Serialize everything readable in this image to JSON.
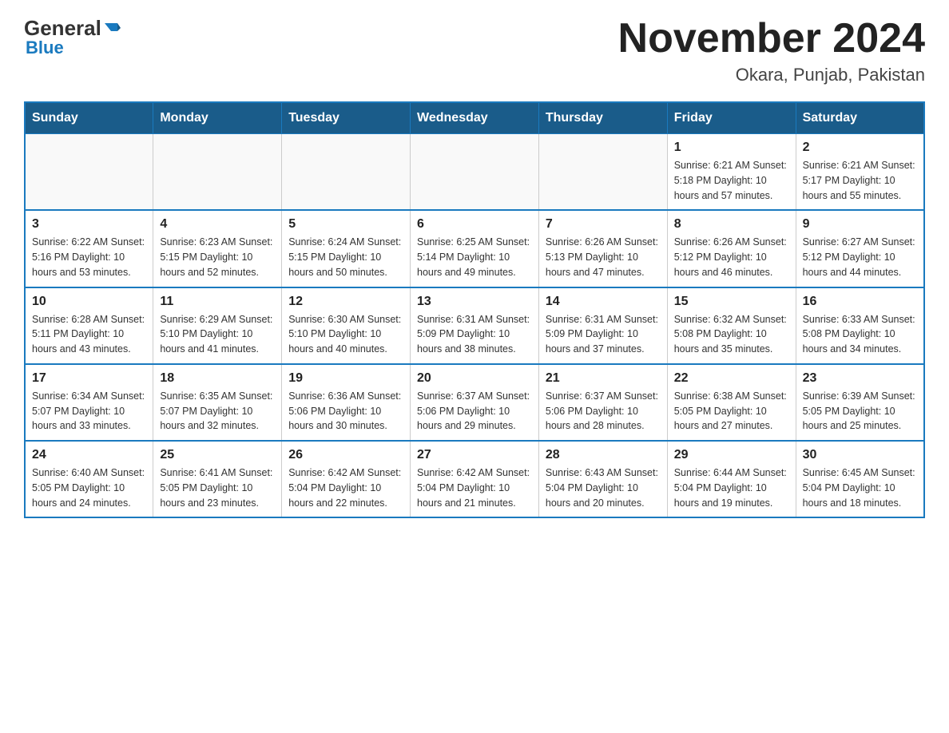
{
  "header": {
    "logo": {
      "general": "General",
      "blue": "Blue"
    },
    "title": "November 2024",
    "location": "Okara, Punjab, Pakistan"
  },
  "calendar": {
    "days_of_week": [
      "Sunday",
      "Monday",
      "Tuesday",
      "Wednesday",
      "Thursday",
      "Friday",
      "Saturday"
    ],
    "weeks": [
      [
        {
          "day": "",
          "info": ""
        },
        {
          "day": "",
          "info": ""
        },
        {
          "day": "",
          "info": ""
        },
        {
          "day": "",
          "info": ""
        },
        {
          "day": "",
          "info": ""
        },
        {
          "day": "1",
          "info": "Sunrise: 6:21 AM\nSunset: 5:18 PM\nDaylight: 10 hours\nand 57 minutes."
        },
        {
          "day": "2",
          "info": "Sunrise: 6:21 AM\nSunset: 5:17 PM\nDaylight: 10 hours\nand 55 minutes."
        }
      ],
      [
        {
          "day": "3",
          "info": "Sunrise: 6:22 AM\nSunset: 5:16 PM\nDaylight: 10 hours\nand 53 minutes."
        },
        {
          "day": "4",
          "info": "Sunrise: 6:23 AM\nSunset: 5:15 PM\nDaylight: 10 hours\nand 52 minutes."
        },
        {
          "day": "5",
          "info": "Sunrise: 6:24 AM\nSunset: 5:15 PM\nDaylight: 10 hours\nand 50 minutes."
        },
        {
          "day": "6",
          "info": "Sunrise: 6:25 AM\nSunset: 5:14 PM\nDaylight: 10 hours\nand 49 minutes."
        },
        {
          "day": "7",
          "info": "Sunrise: 6:26 AM\nSunset: 5:13 PM\nDaylight: 10 hours\nand 47 minutes."
        },
        {
          "day": "8",
          "info": "Sunrise: 6:26 AM\nSunset: 5:12 PM\nDaylight: 10 hours\nand 46 minutes."
        },
        {
          "day": "9",
          "info": "Sunrise: 6:27 AM\nSunset: 5:12 PM\nDaylight: 10 hours\nand 44 minutes."
        }
      ],
      [
        {
          "day": "10",
          "info": "Sunrise: 6:28 AM\nSunset: 5:11 PM\nDaylight: 10 hours\nand 43 minutes."
        },
        {
          "day": "11",
          "info": "Sunrise: 6:29 AM\nSunset: 5:10 PM\nDaylight: 10 hours\nand 41 minutes."
        },
        {
          "day": "12",
          "info": "Sunrise: 6:30 AM\nSunset: 5:10 PM\nDaylight: 10 hours\nand 40 minutes."
        },
        {
          "day": "13",
          "info": "Sunrise: 6:31 AM\nSunset: 5:09 PM\nDaylight: 10 hours\nand 38 minutes."
        },
        {
          "day": "14",
          "info": "Sunrise: 6:31 AM\nSunset: 5:09 PM\nDaylight: 10 hours\nand 37 minutes."
        },
        {
          "day": "15",
          "info": "Sunrise: 6:32 AM\nSunset: 5:08 PM\nDaylight: 10 hours\nand 35 minutes."
        },
        {
          "day": "16",
          "info": "Sunrise: 6:33 AM\nSunset: 5:08 PM\nDaylight: 10 hours\nand 34 minutes."
        }
      ],
      [
        {
          "day": "17",
          "info": "Sunrise: 6:34 AM\nSunset: 5:07 PM\nDaylight: 10 hours\nand 33 minutes."
        },
        {
          "day": "18",
          "info": "Sunrise: 6:35 AM\nSunset: 5:07 PM\nDaylight: 10 hours\nand 32 minutes."
        },
        {
          "day": "19",
          "info": "Sunrise: 6:36 AM\nSunset: 5:06 PM\nDaylight: 10 hours\nand 30 minutes."
        },
        {
          "day": "20",
          "info": "Sunrise: 6:37 AM\nSunset: 5:06 PM\nDaylight: 10 hours\nand 29 minutes."
        },
        {
          "day": "21",
          "info": "Sunrise: 6:37 AM\nSunset: 5:06 PM\nDaylight: 10 hours\nand 28 minutes."
        },
        {
          "day": "22",
          "info": "Sunrise: 6:38 AM\nSunset: 5:05 PM\nDaylight: 10 hours\nand 27 minutes."
        },
        {
          "day": "23",
          "info": "Sunrise: 6:39 AM\nSunset: 5:05 PM\nDaylight: 10 hours\nand 25 minutes."
        }
      ],
      [
        {
          "day": "24",
          "info": "Sunrise: 6:40 AM\nSunset: 5:05 PM\nDaylight: 10 hours\nand 24 minutes."
        },
        {
          "day": "25",
          "info": "Sunrise: 6:41 AM\nSunset: 5:05 PM\nDaylight: 10 hours\nand 23 minutes."
        },
        {
          "day": "26",
          "info": "Sunrise: 6:42 AM\nSunset: 5:04 PM\nDaylight: 10 hours\nand 22 minutes."
        },
        {
          "day": "27",
          "info": "Sunrise: 6:42 AM\nSunset: 5:04 PM\nDaylight: 10 hours\nand 21 minutes."
        },
        {
          "day": "28",
          "info": "Sunrise: 6:43 AM\nSunset: 5:04 PM\nDaylight: 10 hours\nand 20 minutes."
        },
        {
          "day": "29",
          "info": "Sunrise: 6:44 AM\nSunset: 5:04 PM\nDaylight: 10 hours\nand 19 minutes."
        },
        {
          "day": "30",
          "info": "Sunrise: 6:45 AM\nSunset: 5:04 PM\nDaylight: 10 hours\nand 18 minutes."
        }
      ]
    ]
  }
}
